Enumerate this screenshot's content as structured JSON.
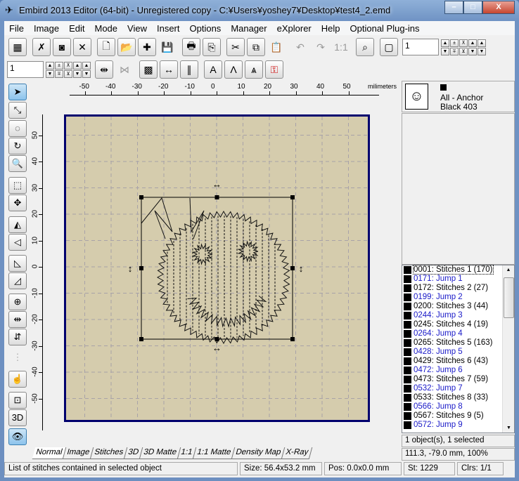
{
  "window": {
    "title": "Embird 2013 Editor (64-bit) - Unregistered copy - C:¥Users¥yoshey7¥Desktop¥test4_2.emd",
    "minimize": "–",
    "maximize": "□",
    "close": "X"
  },
  "menu": [
    "File",
    "Image",
    "Edit",
    "Mode",
    "View",
    "Insert",
    "Options",
    "Manager",
    "eXplorer",
    "Help",
    "Optional Plug-ins"
  ],
  "toolbar1": {
    "buttons": [
      {
        "name": "hoop-icon",
        "glyph": "▦"
      },
      {
        "name": "digitize-icon",
        "glyph": "✗"
      },
      {
        "name": "camera-icon",
        "glyph": "◙"
      },
      {
        "name": "stitch-tool-icon",
        "glyph": "✕"
      },
      {
        "name": "new-file-icon",
        "glyph": "🗋"
      },
      {
        "name": "open-file-icon",
        "glyph": "📂"
      },
      {
        "name": "add-file-icon",
        "glyph": "✚"
      },
      {
        "name": "save-icon",
        "glyph": "💾",
        "disabled": true
      },
      {
        "name": "print-icon",
        "glyph": "🖶"
      },
      {
        "name": "export-icon",
        "glyph": "⎘"
      },
      {
        "name": "cut-icon",
        "glyph": "✂"
      },
      {
        "name": "copy-icon",
        "glyph": "⧉"
      },
      {
        "name": "paste-icon",
        "glyph": "📋",
        "disabled": true
      },
      {
        "name": "undo-icon",
        "glyph": "↶",
        "disabled": true
      },
      {
        "name": "redo-icon",
        "glyph": "↷",
        "disabled": true
      },
      {
        "name": "actual-size-icon",
        "glyph": "1:1",
        "disabled": true
      },
      {
        "name": "zoom-fit-icon",
        "glyph": "⌕"
      },
      {
        "name": "hoop-shape-icon",
        "glyph": "▢"
      }
    ],
    "value": "1"
  },
  "toolbar2": {
    "value": "1",
    "buttons": [
      {
        "name": "split-icon",
        "glyph": "⇹"
      },
      {
        "name": "join-icon",
        "glyph": "⋈",
        "disabled": true
      },
      {
        "name": "fill-icon",
        "glyph": "▩"
      },
      {
        "name": "stitch-length-icon",
        "glyph": "↔"
      },
      {
        "name": "density-icon",
        "glyph": "∥"
      },
      {
        "name": "text-icon",
        "glyph": "A"
      },
      {
        "name": "text-edit-icon",
        "glyph": "Ʌ"
      },
      {
        "name": "monogram-icon",
        "glyph": "ѧ"
      },
      {
        "name": "key-icon",
        "glyph": "⚿"
      }
    ]
  },
  "ruler": {
    "unit": "milimeters",
    "x_ticks": [
      "-50",
      "-40",
      "-30",
      "-20",
      "-10",
      "0",
      "10",
      "20",
      "30",
      "40",
      "50"
    ],
    "y_ticks": [
      "50",
      "40",
      "30",
      "20",
      "10",
      "0",
      "-10",
      "-20",
      "-30",
      "-40",
      "-50"
    ]
  },
  "left_tools": [
    {
      "name": "select-arrow-icon",
      "glyph": "➤",
      "selected": true
    },
    {
      "name": "stitch-select-icon",
      "glyph": "⤡"
    },
    {
      "name": "lasso-select-icon",
      "glyph": "◌"
    },
    {
      "name": "rotate-icon",
      "glyph": "↻"
    },
    {
      "name": "zoom-icon",
      "glyph": "🔍"
    },
    {
      "name": "resize-icon",
      "glyph": "⬚"
    },
    {
      "name": "move-icon",
      "glyph": "✥"
    },
    {
      "name": "mirror-horizontal-icon",
      "glyph": "◭"
    },
    {
      "name": "mirror-vertical-icon",
      "glyph": "◁"
    },
    {
      "name": "rotate-left-icon",
      "glyph": "◺"
    },
    {
      "name": "rotate-right-icon",
      "glyph": "◿"
    },
    {
      "name": "center-icon",
      "glyph": "⊕"
    },
    {
      "name": "center-horizontal-icon",
      "glyph": "⇹"
    },
    {
      "name": "center-vertical-icon",
      "glyph": "⇵"
    },
    {
      "name": "align-icon",
      "glyph": "⋮",
      "disabled": true
    },
    {
      "name": "hand-pointer-icon",
      "glyph": "☝"
    },
    {
      "name": "frame-icon",
      "glyph": "⊡"
    },
    {
      "name": "3d-view-icon",
      "glyph": "3D"
    },
    {
      "name": "preview-icon",
      "glyph": "👁",
      "selected": true
    }
  ],
  "color_panel": {
    "swatch": "#000000",
    "brand": "All - Anchor",
    "color_name": "Black 403"
  },
  "stitch_list": [
    {
      "text": "0001:  Stitches 1 (170)",
      "type": "stitch"
    },
    {
      "text": "0171:  Jump 1",
      "type": "jump"
    },
    {
      "text": "0172:  Stitches 2 (27)",
      "type": "stitch"
    },
    {
      "text": "0199:  Jump 2",
      "type": "jump"
    },
    {
      "text": "0200:  Stitches 3 (44)",
      "type": "stitch"
    },
    {
      "text": "0244:  Jump 3",
      "type": "jump"
    },
    {
      "text": "0245:  Stitches 4 (19)",
      "type": "stitch"
    },
    {
      "text": "0264:  Jump 4",
      "type": "jump"
    },
    {
      "text": "0265:  Stitches 5 (163)",
      "type": "stitch"
    },
    {
      "text": "0428:  Jump 5",
      "type": "jump"
    },
    {
      "text": "0429:  Stitches 6 (43)",
      "type": "stitch"
    },
    {
      "text": "0472:  Jump 6",
      "type": "jump"
    },
    {
      "text": "0473:  Stitches 7 (59)",
      "type": "stitch"
    },
    {
      "text": "0532:  Jump 7",
      "type": "jump"
    },
    {
      "text": "0533:  Stitches 8 (33)",
      "type": "stitch"
    },
    {
      "text": "0566:  Jump 8",
      "type": "jump"
    },
    {
      "text": "0567:  Stitches 9 (5)",
      "type": "stitch"
    },
    {
      "text": "0572:  Jump 9",
      "type": "jump"
    }
  ],
  "selection_info": "1 object(s), 1 selected",
  "cursor_info": "111.3, -79.0 mm, 100%",
  "view_tabs": [
    {
      "label": "Normal",
      "active": true
    },
    {
      "label": "Image"
    },
    {
      "label": "Stitches"
    },
    {
      "label": "3D"
    },
    {
      "label": "3D Matte"
    },
    {
      "label": "1:1"
    },
    {
      "label": "1:1 Matte"
    },
    {
      "label": "Density Map"
    },
    {
      "label": "X-Ray"
    }
  ],
  "statusbar": {
    "hint": "List of stitches contained in selected object",
    "size": "Size: 56.4x53.2 mm",
    "pos": "Pos: 0.0x0.0 mm",
    "stitches": "St: 1229",
    "colors": "Clrs: 1/1"
  },
  "colors": {
    "hoop_border": "#00006e",
    "canvas": "#d5ccad",
    "jump_text": "#1a1ac8",
    "accent_red": "#cc0000"
  }
}
